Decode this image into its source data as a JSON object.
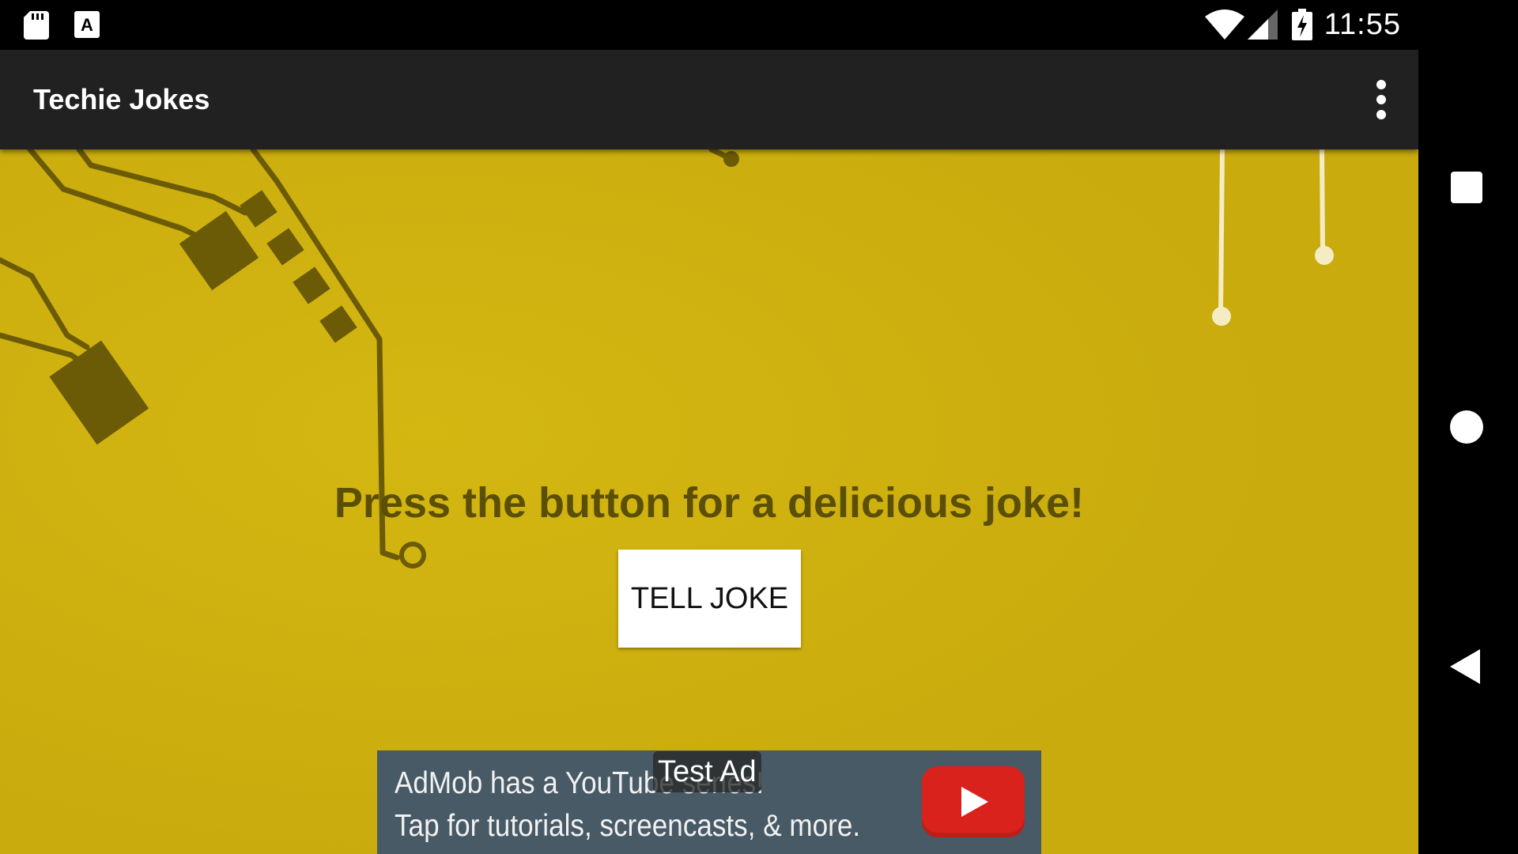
{
  "status_bar": {
    "time": "11:55",
    "icons": [
      "sd-card-icon",
      "font-a-icon",
      "wifi-icon",
      "cell-signal-icon",
      "battery-charging-icon"
    ]
  },
  "app_bar": {
    "title": "Techie Jokes",
    "overflow_icon": "more-vert-icon"
  },
  "main": {
    "headline": "Press the button for a delicious joke!",
    "button_label": "TELL JOKE"
  },
  "ad": {
    "line1": "AdMob has a YouTube series!",
    "line2": "Tap for tutorials, screencasts, & more.",
    "test_label": "Test Ad",
    "logo_icon": "youtube-play-icon"
  },
  "nav_bar": {
    "buttons": [
      "recents-square-icon",
      "home-circle-icon",
      "back-triangle-icon"
    ]
  },
  "colors": {
    "background_yellow": "#cdb010",
    "circuit_dark": "#5b4f05",
    "app_bar": "#212121",
    "ad_background": "#475a66",
    "youtube_red": "#d9221c"
  }
}
